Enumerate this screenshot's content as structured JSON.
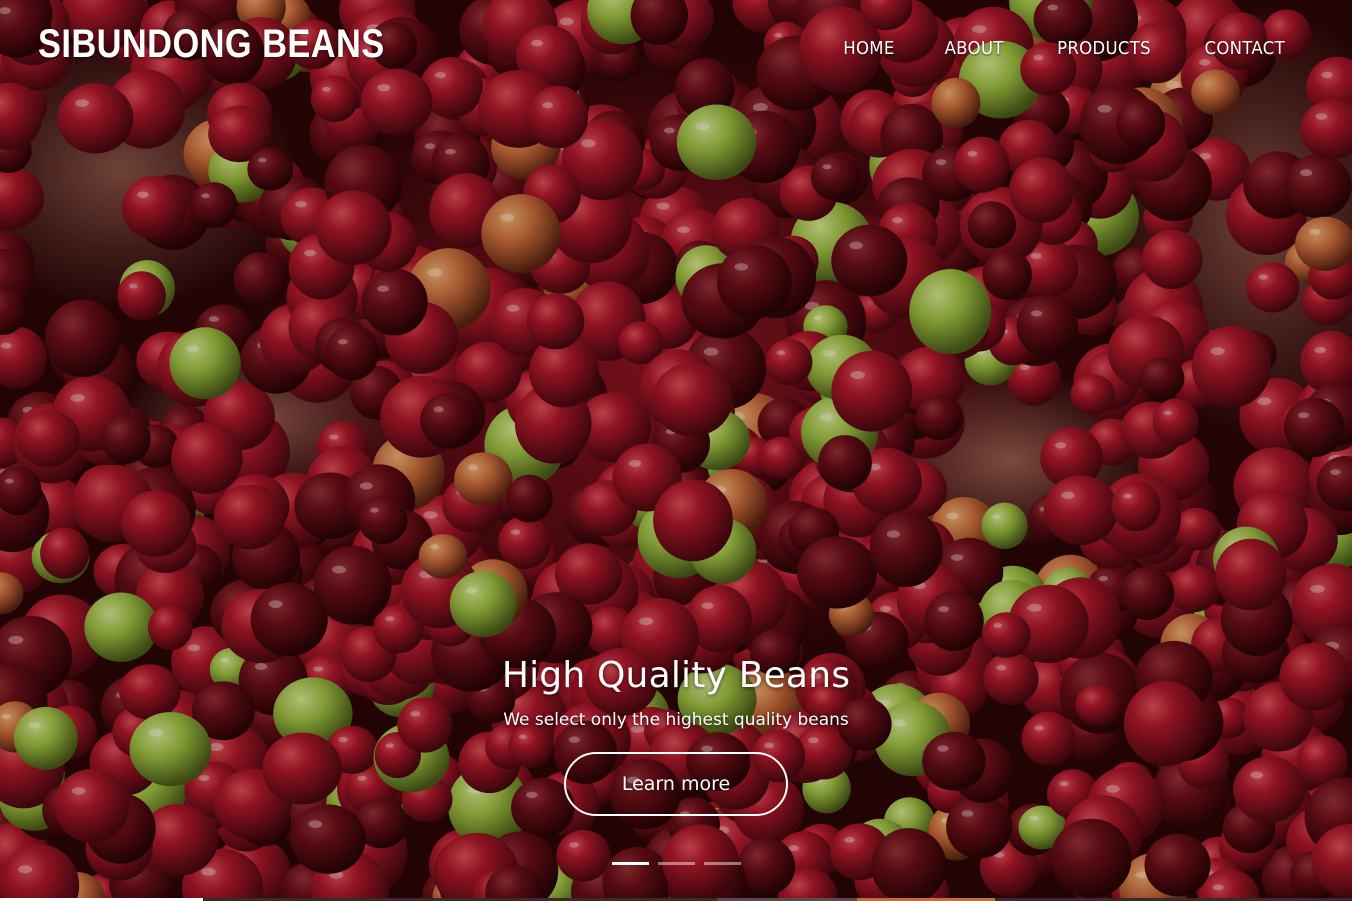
{
  "header": {
    "brand": "SIBUNDONG BEANS",
    "nav": [
      {
        "label": "HOME"
      },
      {
        "label": "ABOUT"
      },
      {
        "label": "PRODUCTS"
      },
      {
        "label": "CONTACT"
      }
    ]
  },
  "hero": {
    "title": "High Quality Beans",
    "subtitle": "We select only the highest quality beans",
    "button_label": "Learn more",
    "slide_count": 3,
    "active_slide": 1,
    "background_image": "coffee-cherries-in-hands"
  },
  "colors": {
    "text": "#ffffff",
    "cherry_red": "#b0182a",
    "cherry_dark": "#5e0c14",
    "skin": "#a8705e"
  }
}
